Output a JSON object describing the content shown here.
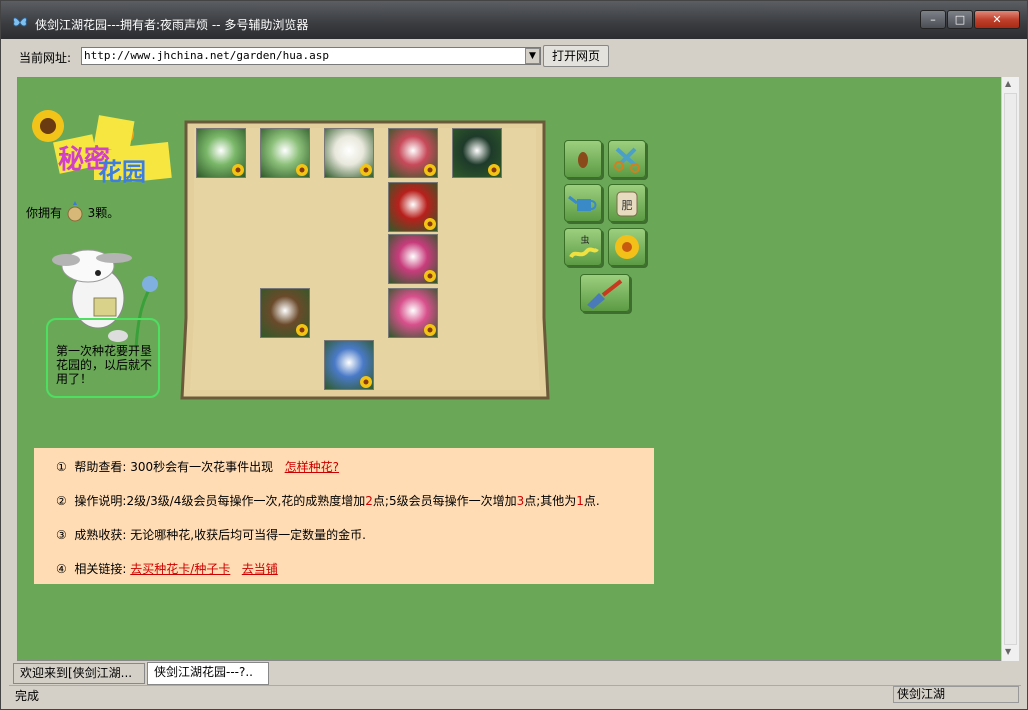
{
  "window": {
    "title": "侠剑江湖花园---拥有者:夜雨声烦 -- 多号辅助浏览器",
    "controls": {
      "minimize": "–",
      "maximize": "□",
      "close": "✕"
    }
  },
  "address_bar": {
    "label": "当前网址:",
    "url": "http://www.jhchina.net/garden/hua.asp",
    "open_button": "打开网页"
  },
  "garden_page": {
    "logo": {
      "line1": "秘密",
      "line2": "花园"
    },
    "seeds": {
      "prefix": "你拥有",
      "count_text": "3颗。"
    },
    "tip": "第一次种花要开垦花园的，以后就不用了！",
    "tools": [
      {
        "name": "seed",
        "icon": "seed-icon"
      },
      {
        "name": "scissors",
        "icon": "scissors-icon"
      },
      {
        "name": "watering-can",
        "icon": "watering-can-icon"
      },
      {
        "name": "fertilizer",
        "icon": "fertilizer-bag-icon",
        "label": "肥"
      },
      {
        "name": "pesticide",
        "icon": "bug-icon",
        "label": "虫"
      },
      {
        "name": "sunflower",
        "icon": "sunflower-icon"
      },
      {
        "name": "trowel",
        "icon": "trowel-icon"
      }
    ],
    "plots": [
      {
        "flower": "white-dandelion",
        "color": "#7bb86a"
      },
      {
        "flower": "white-dandelion",
        "color": "#8cc07a"
      },
      {
        "flower": "white-daisy",
        "color": "#e8e8dc"
      },
      {
        "flower": "bleeding-heart",
        "color": "#c84a5a"
      },
      {
        "flower": "bird-of-paradise",
        "color": "#1e3a2a"
      },
      {
        "flower": "red-poppies",
        "color": "#b8201c"
      },
      {
        "flower": "pink-aster",
        "color": "#c83c7c"
      },
      {
        "flower": "lily",
        "color": "#6a4a2a"
      },
      {
        "flower": "pink-dianthus",
        "color": "#d8508c"
      },
      {
        "flower": "red-tulip-sky",
        "color": "#4a7ac8"
      }
    ],
    "info": {
      "line1": {
        "num": "①",
        "label": "帮助查看:",
        "text": "300秒会有一次花事件出现",
        "link": "怎样种花?"
      },
      "line2": {
        "num": "②",
        "label": "操作说明:",
        "part1": "2级/3级/4级会员每操作一次,花的成熟度增加",
        "red1": "2",
        "part2": "点;5级会员每操作一次增加",
        "red2": "3",
        "part3": "点;其他为",
        "red3": "1",
        "part4": "点."
      },
      "line3": {
        "num": "③",
        "label": "成熟收获:",
        "text": "无论哪种花,收获后均可当得一定数量的金币."
      },
      "line4": {
        "num": "④",
        "label": "相关链接:",
        "link1": "去买种花卡/种子卡",
        "link2": "去当铺"
      }
    }
  },
  "tabs": [
    {
      "label": "欢迎来到[侠剑江湖..."
    },
    {
      "label": "侠剑江湖花园---?.."
    }
  ],
  "status": {
    "left": "完成",
    "right": "侠剑江湖"
  },
  "colors": {
    "page_bg": "#6aa858",
    "info_bg": "#ffdcb4",
    "bubble_border": "#4ede62",
    "link": "#cc0000"
  }
}
